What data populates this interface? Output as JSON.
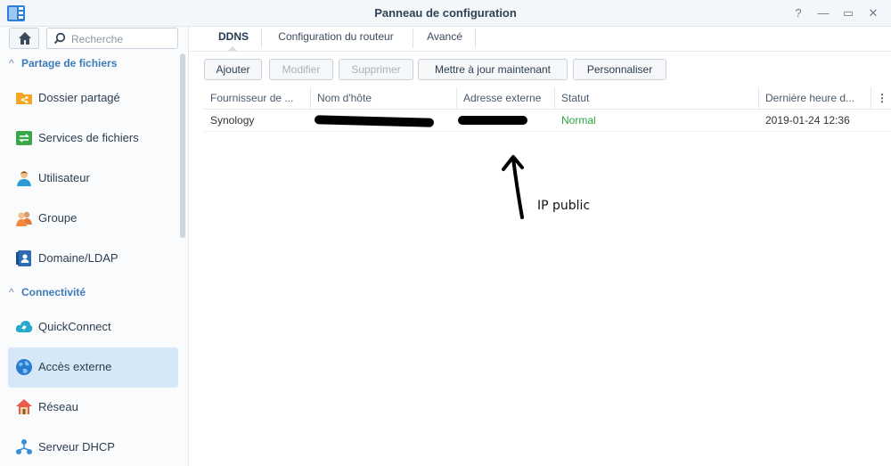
{
  "window": {
    "title": "Panneau de configuration",
    "controls": [
      "?",
      "—",
      "▭",
      "✕"
    ],
    "app_icon": "control-panel-icon"
  },
  "sidebar": {
    "search_placeholder": "Recherche",
    "sections": [
      {
        "label": "Partage de fichiers",
        "items": [
          {
            "label": "Dossier partagé",
            "icon": "shared-folder-icon"
          },
          {
            "label": "Services de fichiers",
            "icon": "file-services-icon"
          },
          {
            "label": "Utilisateur",
            "icon": "user-icon"
          },
          {
            "label": "Groupe",
            "icon": "group-icon"
          },
          {
            "label": "Domaine/LDAP",
            "icon": "domain-ldap-icon"
          }
        ]
      },
      {
        "label": "Connectivité",
        "items": [
          {
            "label": "QuickConnect",
            "icon": "quickconnect-icon"
          },
          {
            "label": "Accès externe",
            "icon": "external-access-icon",
            "active": true
          },
          {
            "label": "Réseau",
            "icon": "network-icon"
          },
          {
            "label": "Serveur DHCP",
            "icon": "dhcp-server-icon"
          }
        ]
      }
    ]
  },
  "tabs": [
    {
      "label": "DDNS",
      "active": true
    },
    {
      "label": "Configuration du routeur"
    },
    {
      "label": "Avancé"
    }
  ],
  "toolbar": {
    "add": "Ajouter",
    "edit": "Modifier",
    "delete": "Supprimer",
    "update_now": "Mettre à jour maintenant",
    "customize": "Personnaliser"
  },
  "table": {
    "columns": [
      "Fournisseur de ...",
      "Nom d'hôte",
      "Adresse externe",
      "Statut",
      "Dernière heure d..."
    ],
    "rows": [
      {
        "provider": "Synology",
        "hostname": "",
        "external_address": "",
        "status": "Normal",
        "last_update": "2019-01-24 12:36"
      }
    ]
  },
  "annotation": {
    "text": "IP public"
  },
  "colors": {
    "accent": "#3d7bb8",
    "status_ok": "#2ea343",
    "active_item_bg": "#d6e7f7"
  }
}
